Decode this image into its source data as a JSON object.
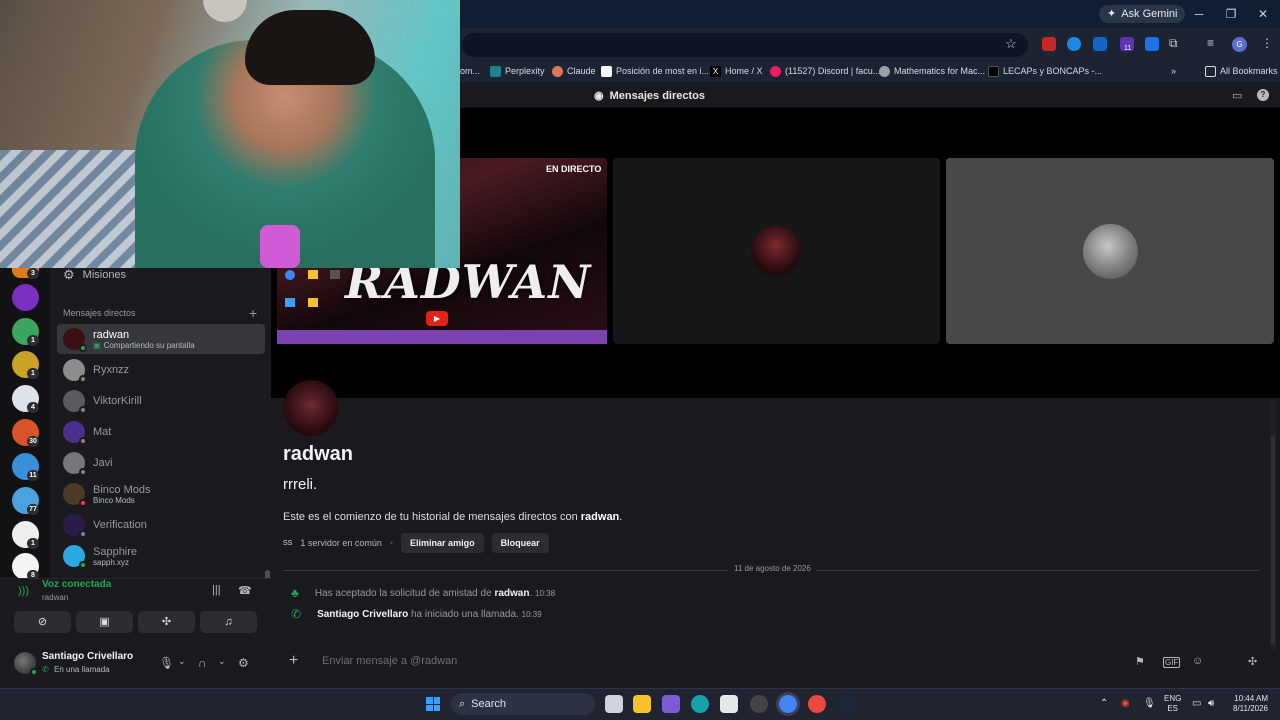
{
  "browser": {
    "ask_gemini": "Ask Gemini",
    "bookmarks": [
      {
        "label": "om...",
        "color": "#5f6368"
      },
      {
        "label": "Perplexity",
        "color": "#20808d"
      },
      {
        "label": "Claude",
        "color": "#d97757"
      },
      {
        "label": "Posición de most en i...",
        "color": "#ffffff"
      },
      {
        "label": "Home / X",
        "color": "#000000"
      },
      {
        "label": "(11527) Discord | facu...",
        "color": "#e91e63"
      },
      {
        "label": "Mathematics for Mac...",
        "color": "#9aa0a6"
      },
      {
        "label": "LECAPs y BONCAPs -...",
        "color": "#000000"
      }
    ],
    "all_bookmarks": "All Bookmarks",
    "extension_badge": "11"
  },
  "discord": {
    "header_title": "Mensajes directos",
    "live_badge": "EN DIRECTO",
    "stream_logo_text": "RADWAN",
    "missions": "Misiones",
    "dm_section": "Mensajes directos",
    "dms": [
      {
        "name": "radwan",
        "sub": "Compartiendo su pantalla",
        "active": true,
        "color": "#3a0f14",
        "status": "#23a559"
      },
      {
        "name": "Ryxnzz",
        "sub": "",
        "active": false,
        "color": "#8d8d8d",
        "status": "#80848e"
      },
      {
        "name": "ViktorKirill",
        "sub": "",
        "active": false,
        "color": "#5a5a5a",
        "status": "#80848e"
      },
      {
        "name": "Mat",
        "sub": "",
        "active": false,
        "color": "#4b2f8a",
        "status": "#80848e"
      },
      {
        "name": "Javi",
        "sub": "",
        "active": false,
        "color": "#777777",
        "status": "#80848e"
      },
      {
        "name": "Binco Mods",
        "sub": "Binco Mods",
        "active": false,
        "color": "#4a3a26",
        "status": "#f23f43"
      },
      {
        "name": "Verification",
        "sub": "",
        "active": false,
        "color": "#2a1b4a",
        "status": "#80848e"
      },
      {
        "name": "Sapphire",
        "sub": "sapph.xyz",
        "active": false,
        "color": "#2aa8e0",
        "status": "#23a559"
      }
    ],
    "servers": [
      {
        "badge": "3",
        "color": "#e07a1f"
      },
      {
        "badge": "",
        "color": "#7b2fbe"
      },
      {
        "badge": "1",
        "color": "#3ba55d"
      },
      {
        "badge": "1",
        "color": "#c9a227"
      },
      {
        "badge": "4",
        "color": "#dde3ea"
      },
      {
        "badge": "30",
        "color": "#d9542b"
      },
      {
        "badge": "11",
        "color": "#3a8fd9"
      },
      {
        "badge": "77",
        "color": "#4aa3df"
      },
      {
        "badge": "1",
        "color": "#eeeeee"
      },
      {
        "badge": "8",
        "color": "#f4f4f4"
      }
    ],
    "voice": {
      "status": "Voz conectada",
      "channel": "radwan"
    },
    "user": {
      "name": "Santiago Crivellaro",
      "status": "En una llamada"
    },
    "chat": {
      "display_name": "radwan",
      "username": "rrreli.",
      "intro_prefix": "Este es el comienzo de tu historial de mensajes directos con ",
      "intro_name": "radwan",
      "intro_suffix": ".",
      "mutual": "1 servidor en común",
      "mutual_icon_text": "SS",
      "remove_friend": "Eliminar amigo",
      "block": "Bloquear",
      "date_divider": "11 de agosto de 2026",
      "system_messages": [
        {
          "text_prefix": "Has aceptado la solicitud de amistad de ",
          "bold": "radwan",
          "text_suffix": ".",
          "time": "10:38"
        },
        {
          "bold": "Santiago Crivellaro",
          "text_suffix": " ha iniciado una llamada.",
          "time": "10:39"
        }
      ],
      "composer_placeholder": "Enviar mensaje a @radwan"
    }
  },
  "taskbar": {
    "search": "Search",
    "lang_top": "ENG",
    "lang_bottom": "ES",
    "time": "10:44 AM",
    "date": "8/11/2026"
  }
}
